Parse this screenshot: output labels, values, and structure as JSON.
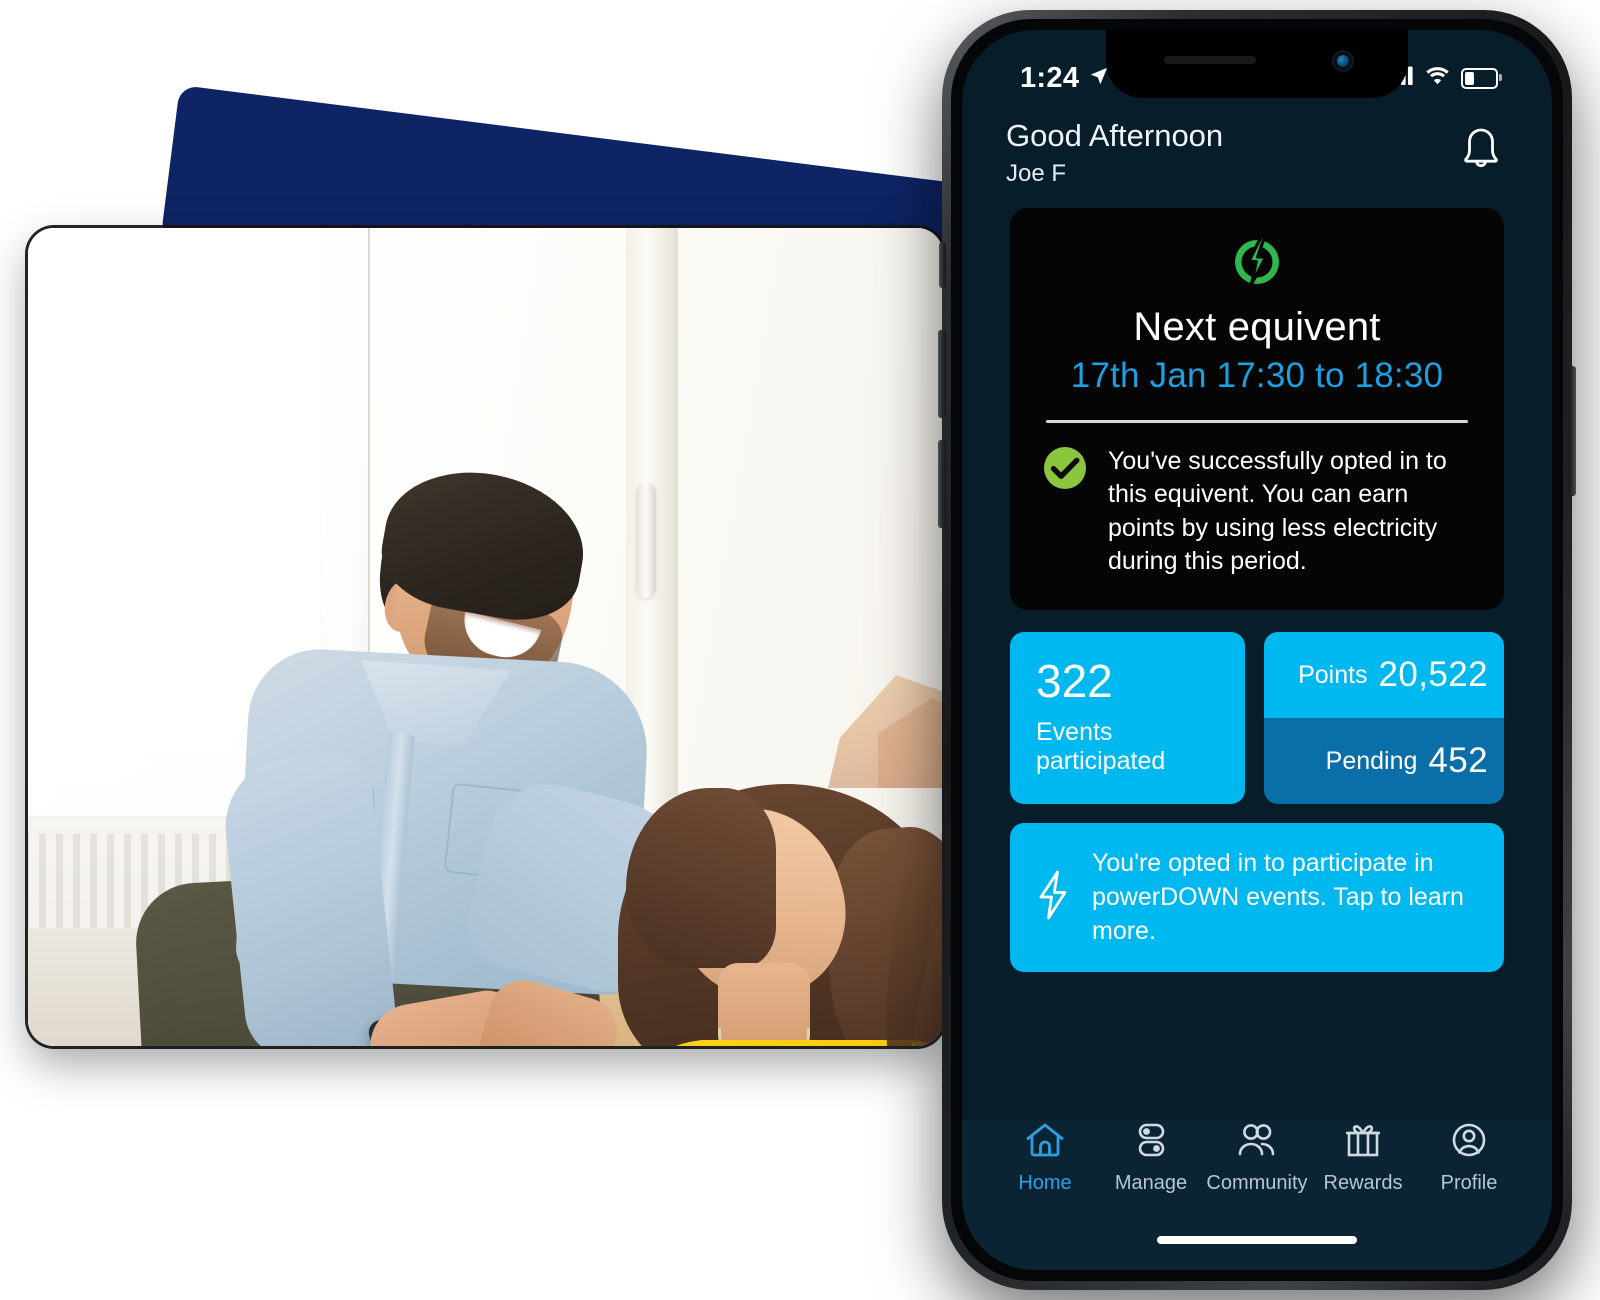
{
  "statusbar": {
    "time": "1:24",
    "location_icon": "location-arrow-icon",
    "cellular_icon": "cellular-signal-icon",
    "wifi_icon": "wifi-icon",
    "battery_icon": "battery-low-icon"
  },
  "header": {
    "greeting": "Good Afternoon",
    "username": "Joe F",
    "notification_icon": "bell-icon"
  },
  "event_card": {
    "badge_icon": "power-bolt-icon",
    "title": "Next equivent",
    "time_range": "17th Jan 17:30 to 18:30",
    "status_icon": "check-circle-icon",
    "status_text": "You've successfully opted in to this equivent. You can earn points by using less electricity during this period."
  },
  "tiles": {
    "events": {
      "value": "322",
      "label": "Events participated"
    },
    "points": {
      "label": "Points",
      "value": "20,522"
    },
    "pending": {
      "label": "Pending",
      "value": "452"
    }
  },
  "banner": {
    "icon": "lightning-bolt-outline-icon",
    "text": "You're opted in to participate in powerDOWN events. Tap to learn more."
  },
  "tabbar": {
    "items": [
      {
        "label": "Home",
        "icon": "home-icon",
        "active": true
      },
      {
        "label": "Manage",
        "icon": "toggles-icon",
        "active": false
      },
      {
        "label": "Community",
        "icon": "people-icon",
        "active": false
      },
      {
        "label": "Rewards",
        "icon": "gift-icon",
        "active": false
      },
      {
        "label": "Profile",
        "icon": "user-circle-icon",
        "active": false
      }
    ]
  },
  "photo": {
    "alt": "Smiling man in light denim shirt showing a smartphone to a woman in a yellow sweater, seated by a bright window"
  },
  "colors": {
    "accent_cyan": "#00b8f0",
    "accent_blue_dark": "#0a6ea8",
    "link_blue": "#1e9fe0",
    "green_badge": "#2fb84c",
    "green_check": "#8cc63e",
    "navy_shape": "#0e2464",
    "screen_bg": "#071d2a",
    "tabbar_bg": "#0b2434",
    "card_bg": "#050505"
  }
}
